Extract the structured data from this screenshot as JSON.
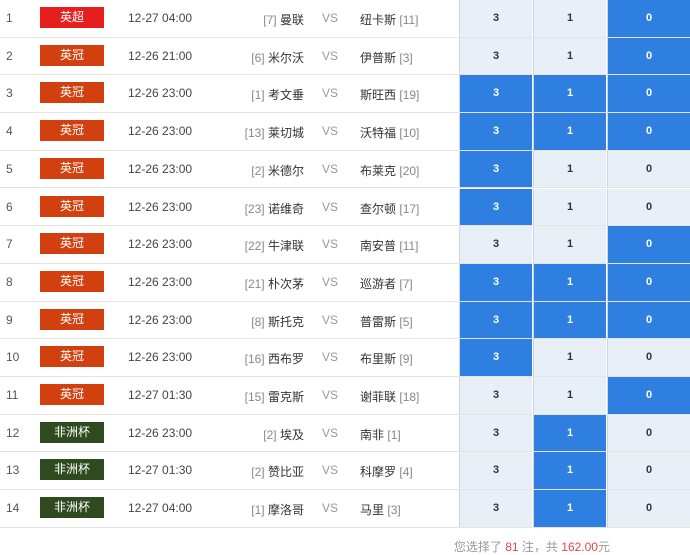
{
  "colors": {
    "epl": "#e61e1e",
    "championship": "#d2400f",
    "afcon": "#2e4a1e",
    "selected": "#2f7fe0",
    "unselected": "#e9eff7"
  },
  "columns": [
    "3",
    "1",
    "0"
  ],
  "matches": [
    {
      "no": "1",
      "league": "英超",
      "league_type": "epl",
      "time": "12-27 04:00",
      "home_rank": "[7]",
      "home": "曼联",
      "vs": "VS",
      "away": "纽卡斯",
      "away_rank": "[11]",
      "selected": [
        false,
        false,
        true
      ]
    },
    {
      "no": "2",
      "league": "英冠",
      "league_type": "championship",
      "time": "12-26 21:00",
      "home_rank": "[6]",
      "home": "米尔沃",
      "vs": "VS",
      "away": "伊普斯",
      "away_rank": "[3]",
      "selected": [
        false,
        false,
        true
      ]
    },
    {
      "no": "3",
      "league": "英冠",
      "league_type": "championship",
      "time": "12-26 23:00",
      "home_rank": "[1]",
      "home": "考文垂",
      "vs": "VS",
      "away": "斯旺西",
      "away_rank": "[19]",
      "selected": [
        true,
        true,
        true
      ]
    },
    {
      "no": "4",
      "league": "英冠",
      "league_type": "championship",
      "time": "12-26 23:00",
      "home_rank": "[13]",
      "home": "莱切城",
      "vs": "VS",
      "away": "沃特福",
      "away_rank": "[10]",
      "selected": [
        true,
        true,
        true
      ]
    },
    {
      "no": "5",
      "league": "英冠",
      "league_type": "championship",
      "time": "12-26 23:00",
      "home_rank": "[2]",
      "home": "米德尔",
      "vs": "VS",
      "away": "布莱克",
      "away_rank": "[20]",
      "selected": [
        true,
        false,
        false
      ]
    },
    {
      "no": "6",
      "league": "英冠",
      "league_type": "championship",
      "time": "12-26 23:00",
      "home_rank": "[23]",
      "home": "诺维奇",
      "vs": "VS",
      "away": "查尔顿",
      "away_rank": "[17]",
      "selected": [
        true,
        false,
        false
      ]
    },
    {
      "no": "7",
      "league": "英冠",
      "league_type": "championship",
      "time": "12-26 23:00",
      "home_rank": "[22]",
      "home": "牛津联",
      "vs": "VS",
      "away": "南安普",
      "away_rank": "[11]",
      "selected": [
        false,
        false,
        true
      ]
    },
    {
      "no": "8",
      "league": "英冠",
      "league_type": "championship",
      "time": "12-26 23:00",
      "home_rank": "[21]",
      "home": "朴次茅",
      "vs": "VS",
      "away": "巡游者",
      "away_rank": "[7]",
      "selected": [
        true,
        true,
        true
      ]
    },
    {
      "no": "9",
      "league": "英冠",
      "league_type": "championship",
      "time": "12-26 23:00",
      "home_rank": "[8]",
      "home": "斯托克",
      "vs": "VS",
      "away": "普雷斯",
      "away_rank": "[5]",
      "selected": [
        true,
        true,
        true
      ]
    },
    {
      "no": "10",
      "league": "英冠",
      "league_type": "championship",
      "time": "12-26 23:00",
      "home_rank": "[16]",
      "home": "西布罗",
      "vs": "VS",
      "away": "布里斯",
      "away_rank": "[9]",
      "selected": [
        true,
        false,
        false
      ]
    },
    {
      "no": "11",
      "league": "英冠",
      "league_type": "championship",
      "time": "12-27 01:30",
      "home_rank": "[15]",
      "home": "雷克斯",
      "vs": "VS",
      "away": "谢菲联",
      "away_rank": "[18]",
      "selected": [
        false,
        false,
        true
      ]
    },
    {
      "no": "12",
      "league": "非洲杯",
      "league_type": "afcon",
      "time": "12-26 23:00",
      "home_rank": "[2]",
      "home": "埃及",
      "vs": "VS",
      "away": "南非",
      "away_rank": "[1]",
      "selected": [
        false,
        true,
        false
      ]
    },
    {
      "no": "13",
      "league": "非洲杯",
      "league_type": "afcon",
      "time": "12-27 01:30",
      "home_rank": "[2]",
      "home": "赞比亚",
      "vs": "VS",
      "away": "科摩罗",
      "away_rank": "[4]",
      "selected": [
        false,
        true,
        false
      ]
    },
    {
      "no": "14",
      "league": "非洲杯",
      "league_type": "afcon",
      "time": "12-27 04:00",
      "home_rank": "[1]",
      "home": "摩洛哥",
      "vs": "VS",
      "away": "马里",
      "away_rank": "[3]",
      "selected": [
        false,
        true,
        false
      ]
    }
  ],
  "footer": {
    "prefix": "您选择了",
    "count": "81",
    "mid": "注，共",
    "amount": "162.00",
    "suffix": "元"
  }
}
